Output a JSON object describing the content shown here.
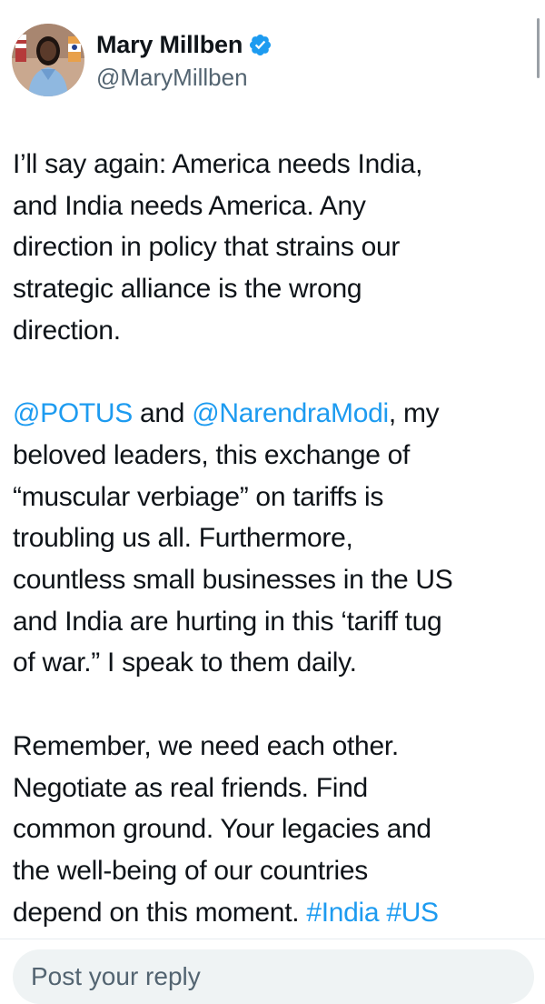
{
  "author": {
    "display_name": "Mary Millben",
    "handle": "@MaryMillben",
    "verified": true,
    "avatar_icon": "profile-photo",
    "verified_icon": "verified-badge-icon"
  },
  "tweet": {
    "p1": [
      "I’ll say again: America needs India,",
      "and India needs America. Any",
      "direction in policy that strains our",
      "strategic alliance is the wrong",
      "direction."
    ],
    "p2_line1": {
      "mention1": "@POTUS",
      "and": " and ",
      "mention2": "@NarendraModi",
      "rest": ", my"
    },
    "p2_rest": [
      "beloved leaders, this exchange of",
      "“muscular verbiage” on tariffs is",
      "troubling us all. Furthermore,",
      "countless small businesses in the US",
      "and India are hurting in this ‘tariff tug",
      "of war.” I speak to them daily."
    ],
    "p3": [
      "Remember, we need each other.",
      "Negotiate as real friends. Find",
      "common ground. Your legacies and",
      "the well-being of our countries"
    ],
    "p3_last": {
      "text": "depend on this moment. ",
      "hashtag1": "#India",
      "space": " ",
      "hashtag2": "#US"
    }
  },
  "reply": {
    "placeholder": "Post your reply"
  },
  "colors": {
    "link": "#1d9bf0",
    "text": "#0f1419",
    "secondary": "#536471"
  }
}
